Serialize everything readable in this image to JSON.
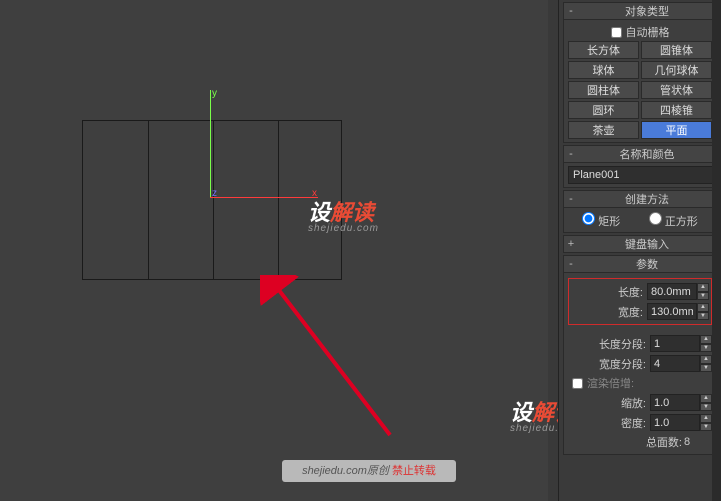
{
  "viewport": {
    "axis_y": "y",
    "axis_x": "x",
    "axis_z": "z"
  },
  "watermark": {
    "brand_cn": "设",
    "brand_red": "解读",
    "brand_sub": "shejiedu.com"
  },
  "footer": {
    "text": "shejiedu.com原创 ",
    "warn": "禁止转载"
  },
  "panel": {
    "object_type": {
      "title": "对象类型",
      "toggle": "-",
      "autogrid": "自动栅格",
      "buttons": [
        "长方体",
        "圆锥体",
        "球体",
        "几何球体",
        "圆柱体",
        "管状体",
        "圆环",
        "四棱锥",
        "茶壶",
        "平面"
      ],
      "active_index": 9
    },
    "name_color": {
      "title": "名称和颜色",
      "toggle": "-",
      "name": "Plane001",
      "swatch": "#f2b600"
    },
    "create_method": {
      "title": "创建方法",
      "toggle": "-",
      "opt_rect": "矩形",
      "opt_square": "正方形"
    },
    "keyboard": {
      "title": "键盘输入",
      "toggle": "+"
    },
    "params": {
      "title": "参数",
      "toggle": "-",
      "length_lbl": "长度:",
      "length_val": "80.0mm",
      "width_lbl": "宽度:",
      "width_val": "130.0mm",
      "lseg_lbl": "长度分段:",
      "lseg_val": "1",
      "wseg_lbl": "宽度分段:",
      "wseg_val": "4",
      "render_mult": "渲染倍增:",
      "scale_lbl": "缩放:",
      "scale_val": "1.0",
      "density_lbl": "密度:",
      "density_val": "1.0",
      "total_faces_lbl": "总面数:",
      "total_faces_val": "8"
    }
  }
}
